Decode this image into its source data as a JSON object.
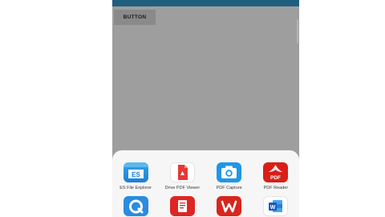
{
  "screen": {
    "button_label": "BUTTON"
  },
  "share_sheet": {
    "apps": [
      {
        "label": "ES File Explorer",
        "icon": "es-file-explorer-icon"
      },
      {
        "label": "Drive PDF Viewer",
        "icon": "drive-pdf-viewer-icon"
      },
      {
        "label": "PDF Capture",
        "icon": "pdf-capture-icon"
      },
      {
        "label": "PDF Reader",
        "icon": "pdf-reader-icon"
      },
      {
        "label": "",
        "icon": "ring-search-app-icon"
      },
      {
        "label": "",
        "icon": "red-document-app-icon"
      },
      {
        "label": "",
        "icon": "wps-office-icon"
      },
      {
        "label": "",
        "icon": "word-app-icon"
      }
    ]
  },
  "colors": {
    "status_bar": "#1f5f7e",
    "scrim": "#9e9e9e",
    "sheet": "#f6f6f6"
  }
}
